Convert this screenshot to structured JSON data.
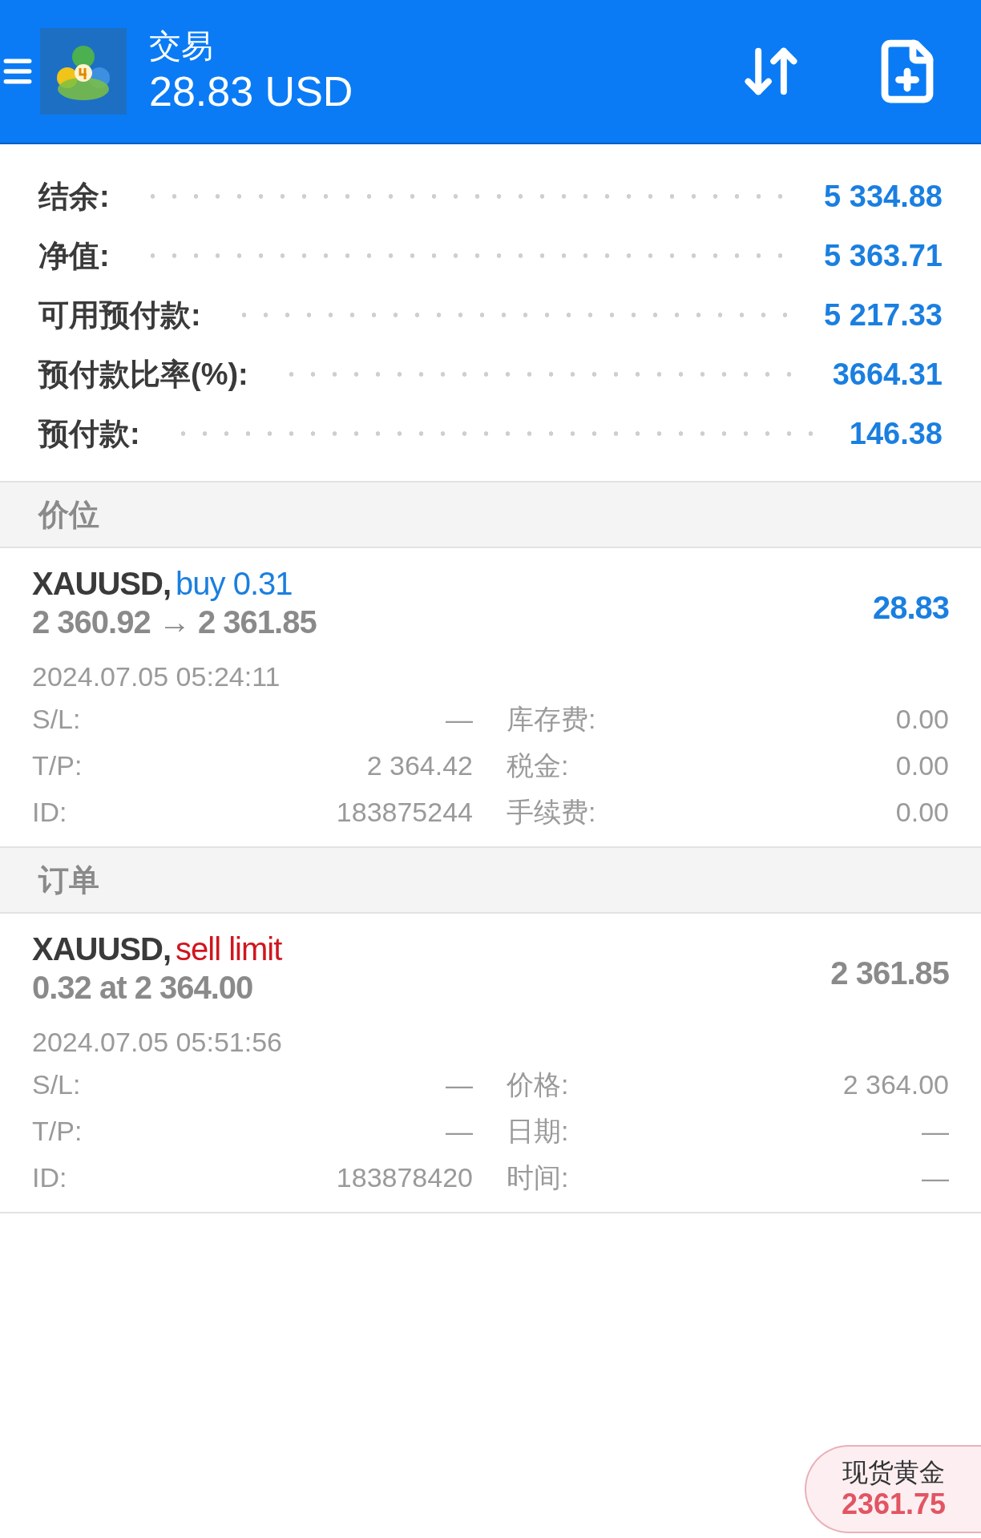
{
  "header": {
    "title": "交易",
    "balance": "28.83 USD"
  },
  "summary": [
    {
      "label": "结余:",
      "value": "5 334.88"
    },
    {
      "label": "净值:",
      "value": "5 363.71"
    },
    {
      "label": "可用预付款:",
      "value": "5 217.33"
    },
    {
      "label": "预付款比率(%):",
      "value": "3664.31"
    },
    {
      "label": "预付款:",
      "value": "146.38"
    }
  ],
  "sections": [
    {
      "title": "价位",
      "items": [
        {
          "symbol": "XAUUSD,",
          "kind": "buy",
          "action": "buy 0.31",
          "line2": "2 360.92 → 2 361.85",
          "value": "28.83",
          "color": "#1a7fe0",
          "time": "2024.07.05 05:24:11",
          "details": [
            [
              "S/L:",
              "—",
              "库存费:",
              "0.00"
            ],
            [
              "T/P:",
              "2 364.42",
              "税金:",
              "0.00"
            ],
            [
              "ID:",
              "183875244",
              "手续费:",
              "0.00"
            ]
          ]
        }
      ]
    },
    {
      "title": "订单",
      "items": [
        {
          "symbol": "XAUUSD,",
          "kind": "sell",
          "action": "sell limit",
          "line2": "0.32 at 2 364.00",
          "value": "2 361.85",
          "color": "#8a8a8a",
          "time": "2024.07.05 05:51:56",
          "details": [
            [
              "S/L:",
              "—",
              "价格:",
              "2 364.00"
            ],
            [
              "T/P:",
              "—",
              "日期:",
              "—"
            ],
            [
              "ID:",
              "183878420",
              "时间:",
              "—"
            ]
          ]
        }
      ]
    }
  ],
  "floating_quote": {
    "name": "现货黄金",
    "price": "2361.75"
  }
}
